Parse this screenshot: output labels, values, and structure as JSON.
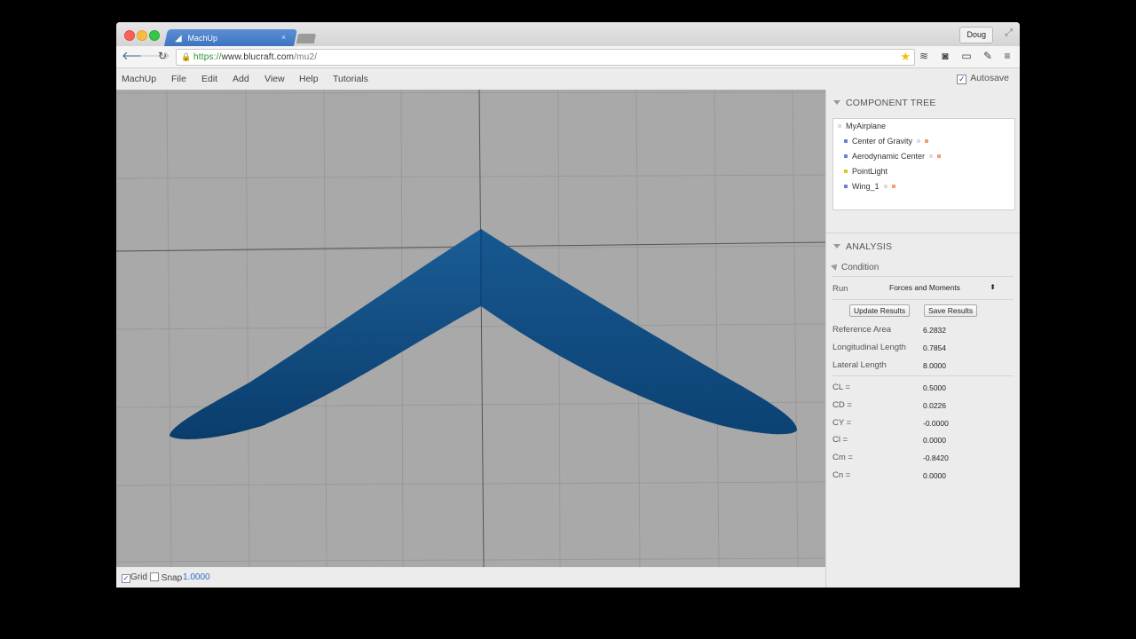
{
  "browser": {
    "tab_title": "MachUp",
    "tab_close": "×",
    "user_label": "Doug",
    "url_scheme": "https://",
    "url_host": "www.blucraft.com",
    "url_path": "/mu2/"
  },
  "menubar": {
    "items": [
      "MachUp",
      "File",
      "Edit",
      "Add",
      "View",
      "Help",
      "Tutorials"
    ],
    "autosave_label": "Autosave",
    "autosave_checked": true
  },
  "viewport": {
    "wing_color": "#0f4f86",
    "background_color": "#a9a9a9"
  },
  "bottombar": {
    "grid_label": "Grid",
    "grid_checked": true,
    "snap_label": "Snap",
    "snap_checked": false,
    "snap_value": "1.0000"
  },
  "component_tree": {
    "title": "COMPONENT TREE",
    "root": "MyAirplane",
    "items": [
      {
        "label": "Center of Gravity",
        "color": "#6b7fd6"
      },
      {
        "label": "Aerodynamic Center",
        "color": "#6b7fd6"
      },
      {
        "label": "PointLight",
        "color": "#d6c81e"
      },
      {
        "label": "Wing_1",
        "color": "#6b7fd6"
      }
    ]
  },
  "analysis": {
    "title": "ANALYSIS",
    "condition_label": "Condition",
    "run_label": "Run",
    "run_value": "Forces and Moments",
    "update_button": "Update Results",
    "save_button": "Save Results",
    "reference": [
      {
        "label": "Reference Area",
        "value": "6.2832"
      },
      {
        "label": "Longitudinal Length",
        "value": "0.7854"
      },
      {
        "label": "Lateral Length",
        "value": "8.0000"
      }
    ],
    "coefficients": [
      {
        "label": "CL =",
        "value": "0.5000"
      },
      {
        "label": "CD =",
        "value": "0.0226"
      },
      {
        "label": "CY =",
        "value": "-0.0000"
      },
      {
        "label": "Cl =",
        "value": "0.0000"
      },
      {
        "label": "Cm =",
        "value": "-0.8420"
      },
      {
        "label": "Cn =",
        "value": "0.0000"
      }
    ]
  }
}
